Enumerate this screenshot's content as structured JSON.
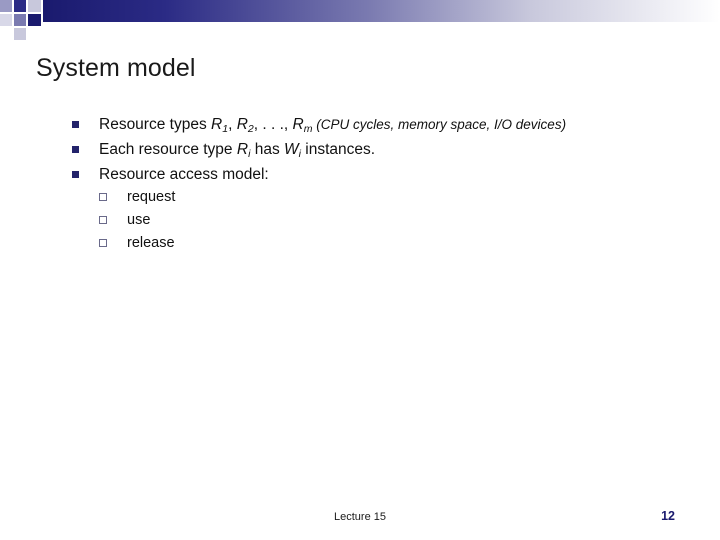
{
  "slide": {
    "title": "System model",
    "bullets": [
      {
        "level": 1,
        "segments": [
          {
            "text": "Resource types ",
            "style": "normal"
          },
          {
            "text": "R",
            "style": "italic"
          },
          {
            "text": "1",
            "style": "sub-italic"
          },
          {
            "text": ", ",
            "style": "normal"
          },
          {
            "text": "R",
            "style": "italic"
          },
          {
            "text": "2",
            "style": "sub-italic"
          },
          {
            "text": ", . . ., ",
            "style": "normal"
          },
          {
            "text": "R",
            "style": "italic"
          },
          {
            "text": "m",
            "style": "sub-italic"
          },
          {
            "text": "  (CPU cycles, memory space, I/O devices)",
            "style": "italic-small"
          }
        ],
        "plain": "Resource types R1, R2, . . ., Rm  (CPU cycles, memory space, I/O devices)"
      },
      {
        "level": 1,
        "plain": "Each resource type Ri has Wi instances."
      },
      {
        "level": 1,
        "plain": "Resource access model:"
      },
      {
        "level": 2,
        "plain": "request"
      },
      {
        "level": 2,
        "plain": "use"
      },
      {
        "level": 2,
        "plain": "release"
      }
    ],
    "footer": {
      "center": "Lecture 15",
      "page_number": "12"
    }
  },
  "colors": {
    "accent_dark": "#1a1a6e",
    "accent_mid": "#7a7ab0",
    "accent_light": "#c8c8dc",
    "bullet": "#23236b",
    "text": "#111111"
  }
}
